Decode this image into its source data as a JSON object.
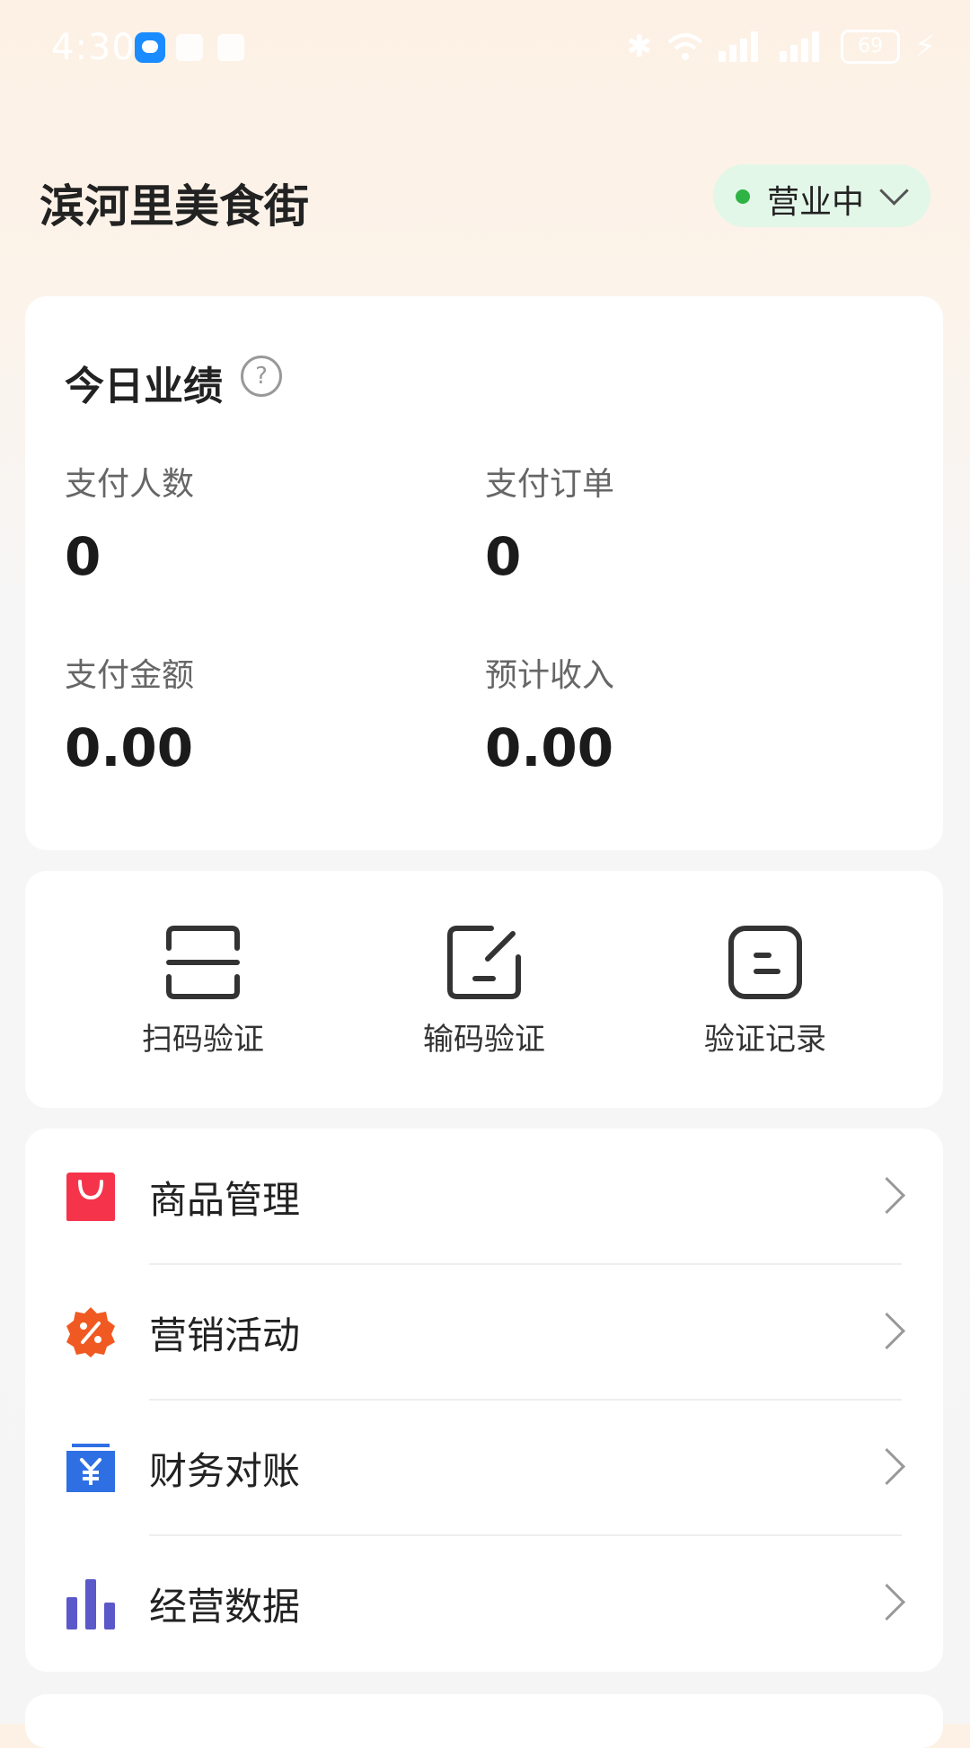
{
  "status_bar": {
    "time": "4:30",
    "battery": "69"
  },
  "header": {
    "store_name": "滨河里美食街",
    "business_status": "营业中"
  },
  "performance": {
    "title": "今日业绩",
    "metrics": [
      {
        "label": "支付人数",
        "value": "0"
      },
      {
        "label": "支付订单",
        "value": "0"
      },
      {
        "label": "支付金额",
        "value": "0.00"
      },
      {
        "label": "预计收入",
        "value": "0.00"
      }
    ]
  },
  "quick_actions": [
    {
      "label": "扫码验证",
      "icon": "scan-icon"
    },
    {
      "label": "输码验证",
      "icon": "edit-code-icon"
    },
    {
      "label": "验证记录",
      "icon": "record-icon"
    }
  ],
  "menu": [
    {
      "label": "商品管理",
      "icon": "shopping-bag-icon",
      "color": "#f5344b"
    },
    {
      "label": "营销活动",
      "icon": "discount-badge-icon",
      "color": "#f05a22"
    },
    {
      "label": "财务对账",
      "icon": "finance-yuan-icon",
      "color": "#2f6fe4"
    },
    {
      "label": "经营数据",
      "icon": "bar-chart-icon",
      "color": "#5b58c9"
    }
  ],
  "colors": {
    "accent_green": "#2fb344",
    "status_bg": "#e3f7e8"
  }
}
